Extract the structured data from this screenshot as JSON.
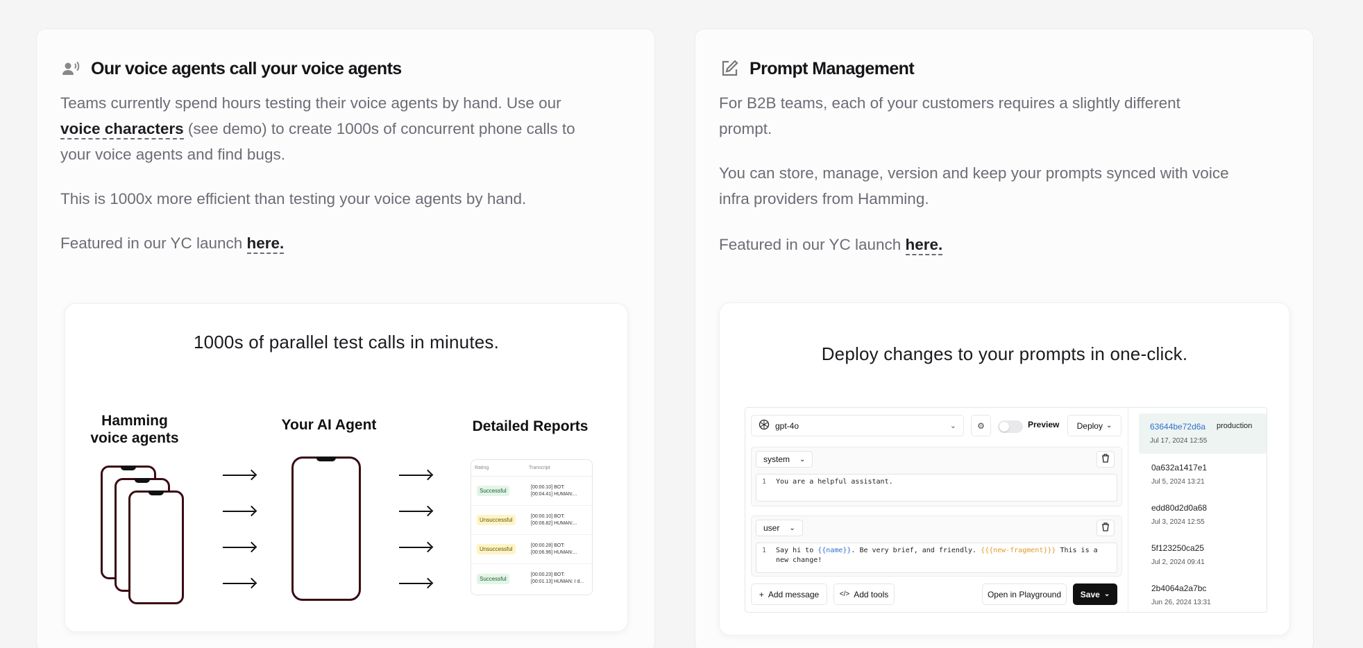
{
  "left_card": {
    "title": "Our voice agents call your voice agents",
    "p1_a": "Teams currently spend hours testing their voice agents by hand. Use our ",
    "p1_link": "voice characters",
    "p1_b": " (see demo) to create 1000s of concurrent phone calls to your voice agents and find bugs.",
    "p2": "This is 1000x more efficient than testing your voice agents by hand.",
    "p3": "Featured in our YC launch ",
    "p3_link": "here.",
    "illustration": {
      "title": "1000s of parallel test calls in minutes.",
      "col1_line1": "Hamming",
      "col1_line2": "voice agents",
      "col2": "Your AI Agent",
      "col3": "Detailed Reports",
      "report_headers": [
        "Rating",
        "Transcript"
      ],
      "report_rows": [
        {
          "status": "Successful",
          "kind": "ok",
          "t1": "[00:00.10] BOT:",
          "t2": "[00:04.41] HUMAN:..."
        },
        {
          "status": "Unsuccessful",
          "kind": "bad",
          "t1": "[00:00.10] BOT:",
          "t2": "[00:06.82] HUMAN:..."
        },
        {
          "status": "Unsuccessful",
          "kind": "bad",
          "t1": "[00:00.28] BOT:",
          "t2": "[00:06.96] HUMAN:..."
        },
        {
          "status": "Successful",
          "kind": "ok",
          "t1": "[00:00.23] BOT:",
          "t2": "[00:01.13] HUMAN: I d..."
        }
      ]
    }
  },
  "right_card": {
    "title": "Prompt Management",
    "p1": "For B2B teams, each of your customers requires a slightly different prompt.",
    "p2": "You can store, manage, version and keep your prompts synced with voice infra providers from Hamming.",
    "p3": "Featured in our YC launch ",
    "p3_link": "here.",
    "illustration": {
      "title": "Deploy changes to your prompts in one-click.",
      "model": "gpt-4o",
      "preview_label": "Preview",
      "deploy_label": "Deploy",
      "messages": [
        {
          "role": "system",
          "line": "1",
          "text": "You are a helpful assistant."
        },
        {
          "role": "user",
          "line": "1",
          "text_a": "Say hi to ",
          "var1": "{{name}}",
          "text_b": ". Be very brief, and friendly. ",
          "var2": "{{{new-fragment}}}",
          "text_c": " This is a new change!"
        }
      ],
      "add_message": "Add message",
      "add_tools": "Add tools",
      "open_playground": "Open in Playground",
      "save": "Save",
      "versions": [
        {
          "hash": "63644be72d6a",
          "tag": "production",
          "date": "Jul 17, 2024 12:55"
        },
        {
          "hash": "0a632a1417e1",
          "tag": "",
          "date": "Jul 5, 2024 13:21"
        },
        {
          "hash": "edd80d2d0a68",
          "tag": "",
          "date": "Jul 3, 2024 12:55"
        },
        {
          "hash": "5f123250ca25",
          "tag": "",
          "date": "Jul 2, 2024 09:41"
        },
        {
          "hash": "2b4064a2a7bc",
          "tag": "",
          "date": "Jun 26, 2024 13:31"
        }
      ]
    }
  },
  "icons": {
    "left_title_icon": "voice-speaking-icon",
    "right_title_icon": "edit-square-icon"
  }
}
